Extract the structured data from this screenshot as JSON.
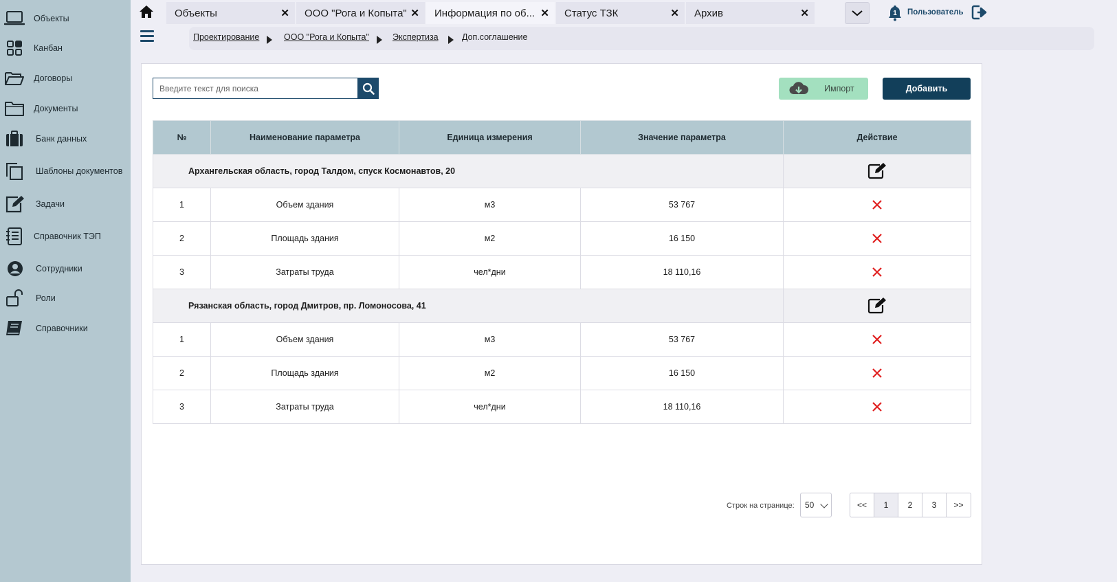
{
  "sidebar": {
    "items": [
      {
        "label": "Объекты",
        "icon": "laptop-icon"
      },
      {
        "label": "Канбан",
        "icon": "kanban-grid-icon"
      },
      {
        "label": "Договоры",
        "icon": "open-folder-icon"
      },
      {
        "label": "Документы",
        "icon": "folder-icon"
      },
      {
        "label": "Банк данных",
        "icon": "briefcase-icon"
      },
      {
        "label": "Шаблоны документов",
        "icon": "copy-icon"
      },
      {
        "label": "Задачи",
        "icon": "edit-icon"
      },
      {
        "label": "Справочник ТЭП",
        "icon": "checklist-icon"
      },
      {
        "label": "Сотрудники",
        "icon": "user-circle-icon"
      },
      {
        "label": "Роли",
        "icon": "unlock-icon"
      },
      {
        "label": "Справочники",
        "icon": "book-icon"
      }
    ]
  },
  "tabs": [
    {
      "label": "Объекты"
    },
    {
      "label": "ООО \"Рога и Копыта\""
    },
    {
      "label": "Информация по об..."
    },
    {
      "label": "Статус ТЗК"
    },
    {
      "label": "Архив"
    }
  ],
  "header": {
    "notifications_count": "1",
    "user_label": "Пользователь"
  },
  "breadcrumb": [
    "Проектирование",
    "ООО \"Рога и Копыта\"",
    "Экспертиза",
    "Доп.соглашение"
  ],
  "toolbar": {
    "search_placeholder": "Введите текст для поиска",
    "import_label": "Импорт",
    "add_label": "Добавить"
  },
  "table": {
    "headers": [
      "№",
      "Наименование параметра",
      "Единица измерения",
      "Значение параметра",
      "Действие"
    ],
    "groups": [
      {
        "title": "Архангельская область, город Талдом, спуск Космонавтов, 20",
        "rows": [
          {
            "num": "1",
            "name": "Объем здания",
            "unit": "м3",
            "value": "53 767"
          },
          {
            "num": "2",
            "name": "Площадь здания",
            "unit": "м2",
            "value": "16 150"
          },
          {
            "num": "3",
            "name": "Затраты труда",
            "unit": "чел*дни",
            "value": "18 110,16"
          }
        ]
      },
      {
        "title": "Рязанская область, город Дмитров, пр. Ломоносова, 41",
        "rows": [
          {
            "num": "1",
            "name": "Объем здания",
            "unit": "м3",
            "value": "53 767"
          },
          {
            "num": "2",
            "name": "Площадь здания",
            "unit": "м2",
            "value": "16 150"
          },
          {
            "num": "3",
            "name": "Затраты труда",
            "unit": "чел*дни",
            "value": "18 110,16"
          }
        ]
      }
    ]
  },
  "pagination": {
    "rows_label": "Строк на странице:",
    "rows_value": "50",
    "pages": [
      "<<",
      "1",
      "2",
      "3",
      ">>"
    ],
    "active_page": "1"
  },
  "colors": {
    "sidebar_bg": "#b4c8d0",
    "accent": "#123f5a",
    "import_bg": "#a3e0bf",
    "delete_red": "#e02020"
  }
}
